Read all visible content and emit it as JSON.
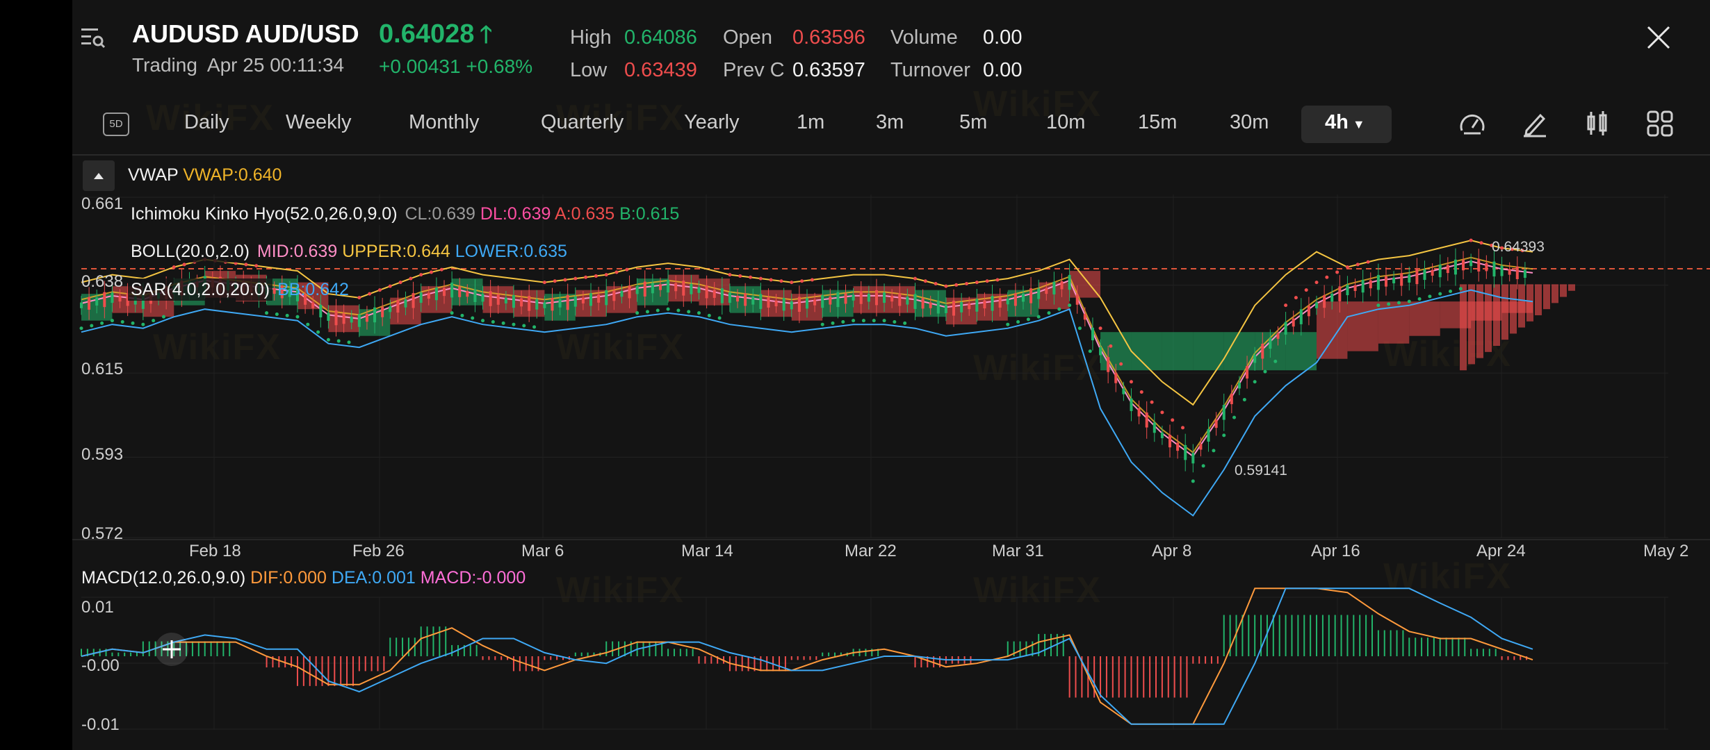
{
  "header": {
    "symbol": "AUDUSD AUD/USD",
    "status": "Trading  Apr 25 00:11:34",
    "price": "0.64028",
    "change": "+0.00431 +0.68%",
    "stats": [
      {
        "label": "High",
        "value": "0.64086",
        "color": "#22b46a"
      },
      {
        "label": "Low",
        "value": "0.63439",
        "color": "#ee4d4d"
      },
      {
        "label": "Open",
        "value": "0.63596",
        "color": "#ee4d4d"
      },
      {
        "label": "Prev C",
        "value": "0.63597",
        "color": "#f2f2f2"
      },
      {
        "label": "Volume",
        "value": "0.00",
        "color": "#f2f2f2"
      },
      {
        "label": "Turnover",
        "value": "0.00",
        "color": "#f2f2f2"
      }
    ]
  },
  "toolbar": {
    "fived": "5D",
    "periods": [
      "Daily",
      "Weekly",
      "Monthly",
      "Quarterly",
      "Yearly",
      "1m",
      "3m",
      "5m",
      "10m",
      "15m",
      "30m"
    ],
    "active": "4h"
  },
  "indicators": {
    "vwap_name": "VWAP",
    "vwap_val": "VWAP:0.640",
    "ichimoku_name": "Ichimoku Kinko Hyo(52.0,26.0,9.0)",
    "ichimoku_cl": "CL:0.639",
    "ichimoku_dl": "DL:0.639",
    "ichimoku_a": "A:0.635",
    "ichimoku_b": "B:0.615",
    "boll_name": "BOLL(20.0,2.0)",
    "boll_mid": "MID:0.639",
    "boll_upper": "UPPER:0.644",
    "boll_lower": "LOWER:0.635",
    "sar_name": "SAR(4.0,2.0,20.0)",
    "sar_bb": "BB:0.642",
    "macd_name": "MACD(12.0,26.0,9.0)",
    "macd_dif": "DIF:0.000",
    "macd_dea": "DEA:0.001",
    "macd_val": "MACD:-0.000"
  },
  "chart_data": {
    "type": "line",
    "price_axis": [
      "0.661",
      "0.638",
      "0.615",
      "0.593",
      "0.572"
    ],
    "ylim": [
      0.572,
      0.661
    ],
    "date_axis": [
      "Feb 18",
      "Feb 26",
      "Mar 6",
      "Mar 14",
      "Mar 22",
      "Mar 31",
      "Apr 8",
      "Apr 16",
      "Apr 24",
      "May 2"
    ],
    "high_marker": "0.64393",
    "low_marker": "0.59141",
    "macd_axis": [
      "0.01",
      "-0.00",
      "-0.01"
    ],
    "close_series": [
      0.632,
      0.634,
      0.633,
      0.636,
      0.638,
      0.637,
      0.636,
      0.635,
      0.629,
      0.628,
      0.631,
      0.634,
      0.636,
      0.634,
      0.633,
      0.632,
      0.633,
      0.634,
      0.636,
      0.637,
      0.636,
      0.634,
      0.633,
      0.632,
      0.633,
      0.634,
      0.634,
      0.633,
      0.631,
      0.632,
      0.633,
      0.635,
      0.638,
      0.62,
      0.606,
      0.598,
      0.592,
      0.604,
      0.618,
      0.626,
      0.632,
      0.636,
      0.638,
      0.639,
      0.641,
      0.643,
      0.641,
      0.64
    ],
    "colors": {
      "up": "#22b46a",
      "down": "#ee4d4d",
      "vwap": "#f0b429",
      "boll_upper": "#f5c542",
      "boll_mid": "#ff8fc7",
      "boll_lower": "#3fa9f5",
      "macd_dif": "#ff9a3c",
      "macd_dea": "#3fa9f5"
    }
  },
  "watermark": "WikiFX"
}
